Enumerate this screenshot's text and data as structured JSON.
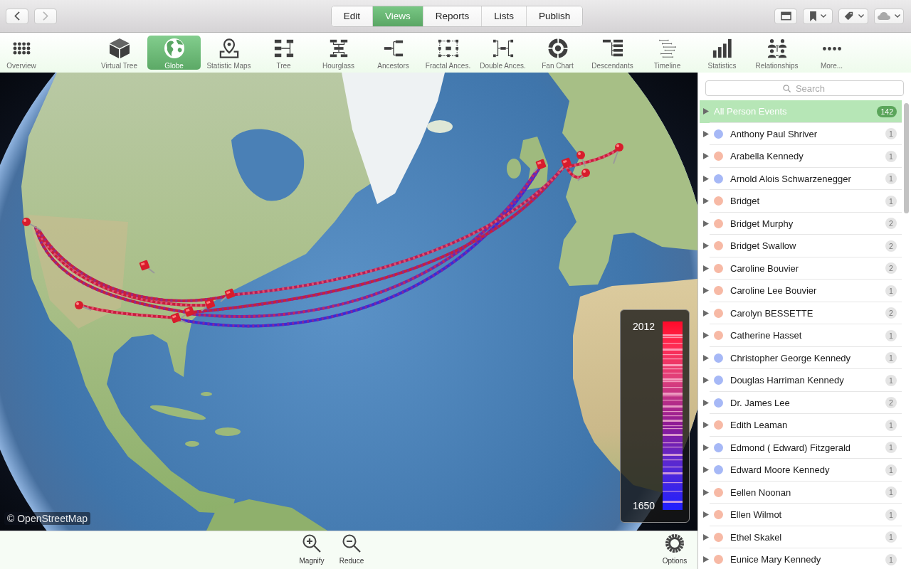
{
  "window_toolbar": {
    "nav_buttons": [
      {
        "kind": "back",
        "disabled": false
      },
      {
        "kind": "forward",
        "disabled": true
      }
    ],
    "tabs": [
      {
        "label": "Edit",
        "selected": false
      },
      {
        "label": "Views",
        "selected": true
      },
      {
        "label": "Reports",
        "selected": false
      },
      {
        "label": "Lists",
        "selected": false
      },
      {
        "label": "Publish",
        "selected": false
      }
    ]
  },
  "views_toolbar": {
    "items": [
      {
        "label": "Overview",
        "selected": false
      },
      {
        "label": "Virtual Tree",
        "selected": false
      },
      {
        "label": "Globe",
        "selected": true
      },
      {
        "label": "Statistic Maps",
        "selected": false
      },
      {
        "label": "Tree",
        "selected": false
      },
      {
        "label": "Hourglass",
        "selected": false
      },
      {
        "label": "Ancestors",
        "selected": false
      },
      {
        "label": "Fractal Ances.",
        "selected": false
      },
      {
        "label": "Double Ances.",
        "selected": false
      },
      {
        "label": "Fan Chart",
        "selected": false
      },
      {
        "label": "Descendants",
        "selected": false
      },
      {
        "label": "Timeline",
        "selected": false
      },
      {
        "label": "Statistics",
        "selected": false
      },
      {
        "label": "Relationships",
        "selected": false
      },
      {
        "label": "More...",
        "selected": false
      }
    ]
  },
  "map": {
    "attribution": "© OpenStreetMap",
    "legend": {
      "max_label": "2012",
      "min_label": "1650"
    }
  },
  "map_controls": [
    {
      "kind": "magnify",
      "label": "Magnify"
    },
    {
      "kind": "reduce",
      "label": "Reduce"
    },
    {
      "kind": "options",
      "label": "Options"
    }
  ],
  "sidebar": {
    "search": {
      "placeholder": "Search"
    },
    "events": [
      {
        "kind": "all",
        "label": "All Person Events",
        "count": "142",
        "selected": true,
        "expanded": false
      },
      {
        "kind": "person",
        "label": "Anthony Paul Shriver",
        "color": "#a6b8f6",
        "count": "1",
        "selected": false,
        "expanded": false
      },
      {
        "kind": "person",
        "label": "Arabella Kennedy",
        "color": "#f7b9a5",
        "count": "1",
        "selected": false,
        "expanded": false
      },
      {
        "kind": "person",
        "label": "Arnold Alois Schwarzenegger",
        "color": "#a6b8f6",
        "count": "1",
        "selected": false,
        "expanded": false
      },
      {
        "kind": "person",
        "label": "Bridget",
        "color": "#f7b9a5",
        "count": "1",
        "selected": false,
        "expanded": false
      },
      {
        "kind": "person",
        "label": "Bridget Murphy",
        "color": "#f7b9a5",
        "count": "2",
        "selected": false,
        "expanded": false
      },
      {
        "kind": "person",
        "label": "Bridget Swallow",
        "color": "#f7b9a5",
        "count": "2",
        "selected": false,
        "expanded": false
      },
      {
        "kind": "person",
        "label": "Caroline Bouvier",
        "color": "#f7b9a5",
        "count": "2",
        "selected": false,
        "expanded": false
      },
      {
        "kind": "person",
        "label": "Caroline Lee Bouvier",
        "color": "#f7b9a5",
        "count": "1",
        "selected": false,
        "expanded": false
      },
      {
        "kind": "person",
        "label": "Carolyn BESSETTE",
        "color": "#f7b9a5",
        "count": "2",
        "selected": false,
        "expanded": false
      },
      {
        "kind": "person",
        "label": "Catherine Hasset",
        "color": "#f7b9a5",
        "count": "1",
        "selected": false,
        "expanded": false
      },
      {
        "kind": "person",
        "label": "Christopher George Kennedy",
        "color": "#a6b8f6",
        "count": "1",
        "selected": false,
        "expanded": false
      },
      {
        "kind": "person",
        "label": "Douglas Harriman Kennedy",
        "color": "#a6b8f6",
        "count": "1",
        "selected": false,
        "expanded": false
      },
      {
        "kind": "person",
        "label": "Dr. James Lee",
        "color": "#a6b8f6",
        "count": "2",
        "selected": false,
        "expanded": false
      },
      {
        "kind": "person",
        "label": "Edith Leaman",
        "color": "#f7b9a5",
        "count": "1",
        "selected": false,
        "expanded": false
      },
      {
        "kind": "person",
        "label": "Edmond ( Edward) Fitzgerald",
        "color": "#a6b8f6",
        "count": "1",
        "selected": false,
        "expanded": false
      },
      {
        "kind": "person",
        "label": "Edward Moore Kennedy",
        "color": "#a6b8f6",
        "count": "1",
        "selected": false,
        "expanded": false
      },
      {
        "kind": "person",
        "label": "Eellen Noonan",
        "color": "#f7b9a5",
        "count": "1",
        "selected": false,
        "expanded": false
      },
      {
        "kind": "person",
        "label": "Ellen Wilmot",
        "color": "#f7b9a5",
        "count": "1",
        "selected": false,
        "expanded": false
      },
      {
        "kind": "person",
        "label": "Ethel Skakel",
        "color": "#f7b9a5",
        "count": "1",
        "selected": false,
        "expanded": false
      },
      {
        "kind": "person",
        "label": "Eunice Mary Kennedy",
        "color": "#f7b9a5",
        "count": "1",
        "selected": false,
        "expanded": false
      }
    ]
  }
}
